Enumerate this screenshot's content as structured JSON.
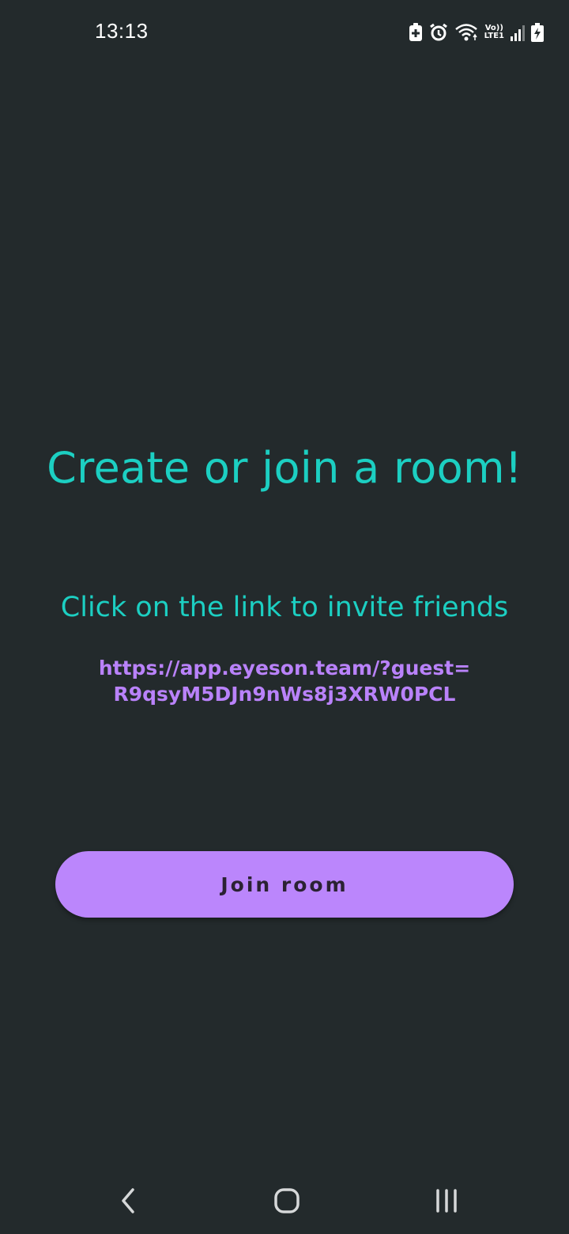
{
  "status_bar": {
    "time": "13:13",
    "icons": [
      "battery-saver-icon",
      "alarm-icon",
      "wifi-icon",
      "volte-lte1-icon",
      "signal-icon",
      "battery-charging-icon"
    ],
    "volte_label": "Vo))",
    "lte_label": "LTE1"
  },
  "main": {
    "title": "Create or join a room!",
    "subtitle": "Click on the link to invite friends",
    "invite_link_line1": "https://app.eyeson.team/?guest=",
    "invite_link_line2": "R9qsyM5DJn9nWs8j3XRW0PCL",
    "join_button_label": "Join room"
  },
  "nav_bar": {
    "buttons": [
      "back-icon",
      "home-icon",
      "recents-icon"
    ]
  },
  "colors": {
    "background": "#232a2c",
    "title_teal": "#1ccfc2",
    "link_purple": "#b982fa",
    "button_purple": "#bb86fc",
    "button_text": "#2b2233"
  }
}
